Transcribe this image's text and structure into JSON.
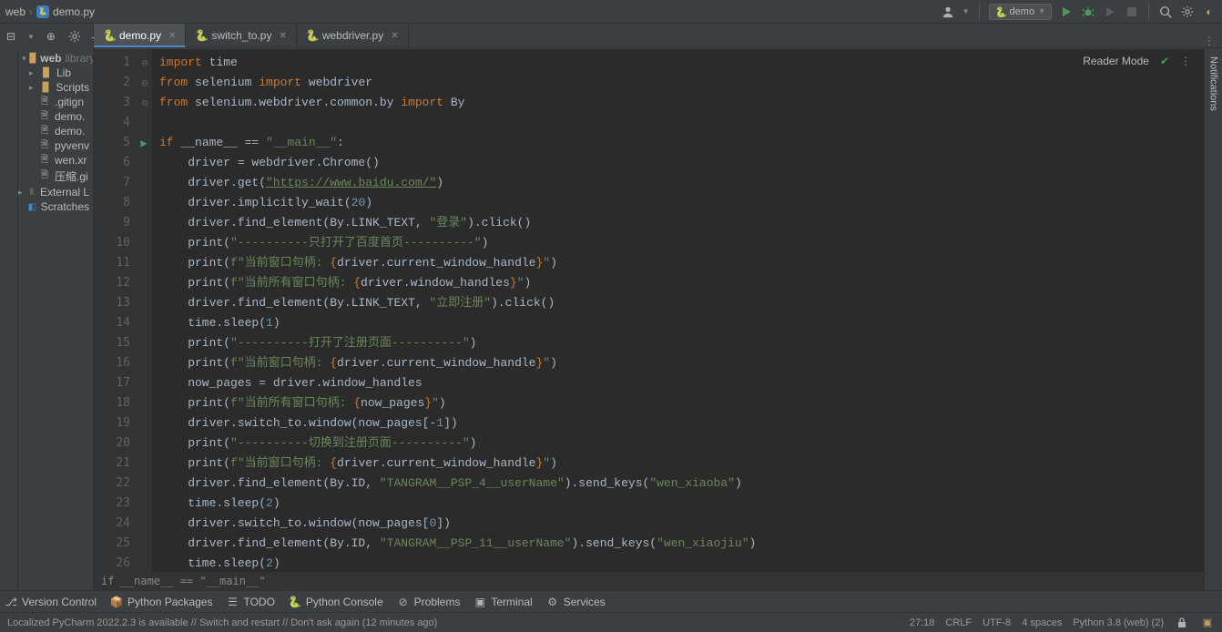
{
  "breadcrumb": {
    "folder": "web",
    "file": "demo.py"
  },
  "run_config": "demo",
  "tabs": [
    {
      "name": "demo.py",
      "active": true
    },
    {
      "name": "switch_to.py",
      "active": false
    },
    {
      "name": "webdriver.py",
      "active": false
    }
  ],
  "project_tree": {
    "root": {
      "name": "web",
      "hint": "library"
    },
    "children": [
      {
        "type": "folder",
        "name": "Lib"
      },
      {
        "type": "folder",
        "name": "Scripts"
      },
      {
        "type": "file",
        "name": ".gitign"
      },
      {
        "type": "file",
        "name": "demo."
      },
      {
        "type": "file",
        "name": "demo."
      },
      {
        "type": "file",
        "name": "pyvenv"
      },
      {
        "type": "file",
        "name": "wen.xr"
      },
      {
        "type": "file",
        "name": "压缩.gi"
      }
    ],
    "external": "External L",
    "scratches": "Scratches"
  },
  "reader_mode": "Reader Mode",
  "notifications_label": "Notifications",
  "gutter": {
    "start": 1,
    "end": 26,
    "run_line": 5
  },
  "code_tokens": [
    [
      [
        "kw",
        "import"
      ],
      [
        "",
        " time"
      ]
    ],
    [
      [
        "kw",
        "from"
      ],
      [
        "",
        " selenium "
      ],
      [
        "kw",
        "import"
      ],
      [
        "",
        " webdriver"
      ]
    ],
    [
      [
        "kw",
        "from"
      ],
      [
        "",
        " selenium.webdriver.common.by "
      ],
      [
        "kw",
        "import"
      ],
      [
        "",
        " By"
      ]
    ],
    [
      [
        "",
        ""
      ]
    ],
    [
      [
        "kw",
        "if"
      ],
      [
        "",
        " __name__ == "
      ],
      [
        "str",
        "\"__main__\""
      ],
      [
        "",
        ":"
      ]
    ],
    [
      [
        "",
        "    driver = webdriver.Chrome()"
      ]
    ],
    [
      [
        "",
        "    driver.get("
      ],
      [
        "link",
        "\"https://www.baidu.com/\""
      ],
      [
        "",
        ")"
      ]
    ],
    [
      [
        "",
        "    driver.implicitly_wait("
      ],
      [
        "num",
        "20"
      ],
      [
        "",
        ")"
      ]
    ],
    [
      [
        "",
        "    driver.find_element(By.LINK_TEXT, "
      ],
      [
        "str",
        "\"登录\""
      ],
      [
        "",
        ").click()"
      ]
    ],
    [
      [
        "",
        "    print("
      ],
      [
        "str",
        "\"----------只打开了百度首页----------\""
      ],
      [
        "",
        ")"
      ]
    ],
    [
      [
        "",
        "    print("
      ],
      [
        "fstr",
        "f\"当前窗口句柄: "
      ],
      [
        "brace",
        "{"
      ],
      [
        "",
        "driver.current_window_handle"
      ],
      [
        "brace",
        "}"
      ],
      [
        "fstr",
        "\""
      ],
      [
        "",
        ")"
      ]
    ],
    [
      [
        "",
        "    print("
      ],
      [
        "fstr",
        "f\"当前所有窗口句柄: "
      ],
      [
        "brace",
        "{"
      ],
      [
        "",
        "driver.window_handles"
      ],
      [
        "brace",
        "}"
      ],
      [
        "fstr",
        "\""
      ],
      [
        "",
        ")"
      ]
    ],
    [
      [
        "",
        "    driver.find_element(By.LINK_TEXT, "
      ],
      [
        "str",
        "\"立即注册\""
      ],
      [
        "",
        ").click()"
      ]
    ],
    [
      [
        "",
        "    time.sleep("
      ],
      [
        "num",
        "1"
      ],
      [
        "",
        ")"
      ]
    ],
    [
      [
        "",
        "    print("
      ],
      [
        "str",
        "\"----------打开了注册页面----------\""
      ],
      [
        "",
        ")"
      ]
    ],
    [
      [
        "",
        "    print("
      ],
      [
        "fstr",
        "f\"当前窗口句柄: "
      ],
      [
        "brace",
        "{"
      ],
      [
        "",
        "driver.current_window_handle"
      ],
      [
        "brace",
        "}"
      ],
      [
        "fstr",
        "\""
      ],
      [
        "",
        ")"
      ]
    ],
    [
      [
        "",
        "    now_pages = driver.window_handles"
      ]
    ],
    [
      [
        "",
        "    print("
      ],
      [
        "fstr",
        "f\"当前所有窗口句柄: "
      ],
      [
        "brace",
        "{"
      ],
      [
        "",
        "now_pages"
      ],
      [
        "brace",
        "}"
      ],
      [
        "fstr",
        "\""
      ],
      [
        "",
        ")"
      ]
    ],
    [
      [
        "",
        "    driver.switch_to.window(now_pages[-"
      ],
      [
        "num",
        "1"
      ],
      [
        "",
        "])"
      ]
    ],
    [
      [
        "",
        "    print("
      ],
      [
        "str",
        "\"----------切换到注册页面----------\""
      ],
      [
        "",
        ")"
      ]
    ],
    [
      [
        "",
        "    print("
      ],
      [
        "fstr",
        "f\"当前窗口句柄: "
      ],
      [
        "brace",
        "{"
      ],
      [
        "",
        "driver.current_window_handle"
      ],
      [
        "brace",
        "}"
      ],
      [
        "fstr",
        "\""
      ],
      [
        "",
        ")"
      ]
    ],
    [
      [
        "",
        "    driver.find_element(By.ID, "
      ],
      [
        "str",
        "\"TANGRAM__PSP_4__userName\""
      ],
      [
        "",
        ").send_keys("
      ],
      [
        "str",
        "\"wen_xiaoba\""
      ],
      [
        "",
        ")"
      ]
    ],
    [
      [
        "",
        "    time.sleep("
      ],
      [
        "num",
        "2"
      ],
      [
        "",
        ")"
      ]
    ],
    [
      [
        "",
        "    driver.switch_to.window(now_pages["
      ],
      [
        "num",
        "0"
      ],
      [
        "",
        "])"
      ]
    ],
    [
      [
        "",
        "    driver.find_element(By.ID, "
      ],
      [
        "str",
        "\"TANGRAM__PSP_11__userName\""
      ],
      [
        "",
        ").send_keys("
      ],
      [
        "str",
        "\"wen_xiaojiu\""
      ],
      [
        "",
        ")"
      ]
    ],
    [
      [
        "",
        "    time.sleep("
      ],
      [
        "num",
        "2"
      ],
      [
        "",
        ")"
      ]
    ]
  ],
  "code_breadcrumb": "if __name__ == \"__main__\"",
  "bottom_panels": [
    "Version Control",
    "Python Packages",
    "TODO",
    "Python Console",
    "Problems",
    "Terminal",
    "Services"
  ],
  "status": {
    "left": "Localized PyCharm 2022.2.3 is available // Switch and restart // Don't ask again (12 minutes ago)",
    "caret": "27:18",
    "line_sep": "CRLF",
    "encoding": "UTF-8",
    "indent": "4 spaces",
    "interpreter": "Python 3.8 (web) (2)"
  }
}
